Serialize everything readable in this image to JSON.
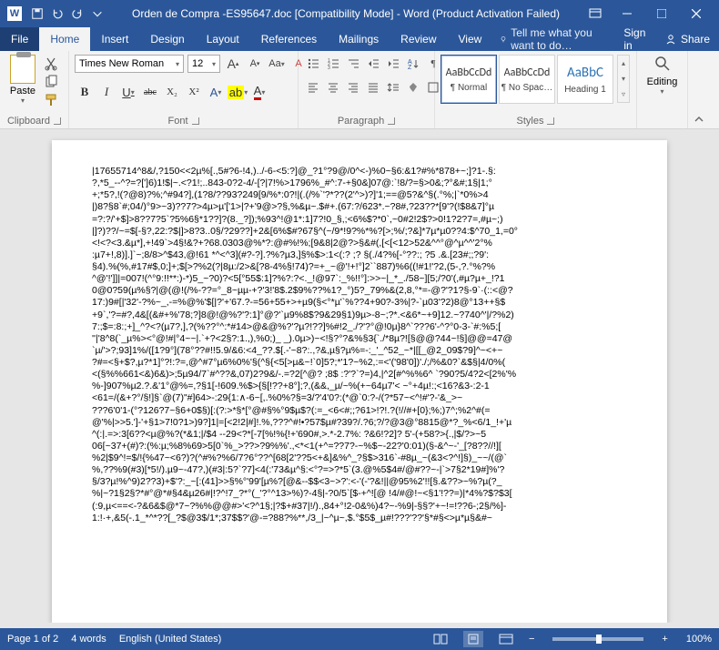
{
  "titlebar": {
    "filename": "Orden de Compra -ES95647.doc [Compatibility Mode] - Word (Product Activation Failed)"
  },
  "menu": {
    "file": "File",
    "home": "Home",
    "insert": "Insert",
    "design": "Design",
    "layout": "Layout",
    "references": "References",
    "mailings": "Mailings",
    "review": "Review",
    "view": "View",
    "tellme": "Tell me what you want to do…",
    "signin": "Sign in",
    "share": "Share"
  },
  "ribbon": {
    "clipboard": {
      "label": "Clipboard",
      "paste": "Paste"
    },
    "font": {
      "label": "Font",
      "name": "Times New Roman",
      "size": "12",
      "grow": "A",
      "shrink": "A",
      "case": "Aa",
      "clear": "A",
      "bold": "B",
      "italic": "I",
      "underline": "U",
      "strike": "abc",
      "sub": "X₂",
      "sup": "X²",
      "effects": "A",
      "highlight": "ab",
      "color": "A"
    },
    "paragraph": {
      "label": "Paragraph"
    },
    "styles": {
      "label": "Styles",
      "gallery": [
        {
          "preview": "AaBbCcDd",
          "name": "¶ Normal"
        },
        {
          "preview": "AaBbCcDd",
          "name": "¶ No Spac…"
        },
        {
          "preview": "AaBbC",
          "name": "Heading 1"
        }
      ]
    },
    "editing": {
      "label": "Editing"
    }
  },
  "document": {
    "lines": [
      "|17655714^8&/,?150<<2µ%[.,5#?6-!4,)../-6-<5:?]@_?1°?9@/0^<-)%0~§6:&1?#%*878+~;]?1-.§:",
      "?,*5_--^?=?[']6)1!$|~.<?1!;..843-0?2-4/-[?|7!%>1796%_#^:7-+§0&]07@:`!8/?=§>0&;?°&#;1§|1;°",
      "+;*5?,!(?@8)?%;^#94?],(1?8/??93?249[9/%*:0?!|(.(/%`'?*??(2'^>)?]'1;==@5?&^§(.°%;|`*0%>4",
      "|)8?§8`#;04/)°9>~3)??7?>4µ>µ'['1>|?+'9@>?§,%&µ~.$#+.(67:?/623*.~?8#,?23??*[9'?(!$8&7]°µ",
      "=?:?/'+$]>8??7?5`?5%6§*1??]?(8._?]);%93^!@1*:1]7?!0_§,;<6%$?*0`,~0#2!2$?>0!1?2?7=,#µ~;)",
      "|]?)??/~=$[-§?,22:?$|]>8?3..0§/?29??]+2&[6%$#?67§^(~/9*!9?%*%?[>;%/;?&]*7µ*µ0??4:$^70_1,=0°",
      "<!<?<3.&µ*],+!49`>4§!&?+?68.0303@%*?:@#%!%;[9&8|2@?>§&#(,[<[<12>52&^^°@^µ^^'2°%",
      ":µ7+!,8)].]`~;8/8>^$43,@!61 *^<^3](#?-?].?%?µ3,]§%$>:1<(:? ;? §(./4?%[-°??:; ?5 .&.[23#;;?9':",
      "§4).%(%,#17#$,0;]+;$[>?%2(?|8µ:/2>&[?8-4%§!74)?=+_~@'!+!°]2``887)%6((!#1!'?2,(5-,?.°%?%",
      "^@'!']]|=007!(^°9:!!**:)-*)5_~?0)?<5[°55$:1]?%?:?<._!@97`:_%!!°]:>>~|_*_./58~][5;/?0'(,#µ?µ+_!?1",
      "0@0?59(µ%§?|@(@!(/%-??=°_8~µµ-+?'3!'8$.2$9%??%1?_°)5?_79%&(2,8,°*=-@?'?1?§-9`·(::<@?",
      "17:)9#[|'32'-?%~_,-=%@%'$[|?'+'67.?-=56+55+>+µ9(§<°*µ'`%??4+90?-3%|?-`µ03'?2)8@°13++§$",
      "+9`,'?=#?,4&[(&#+%'78;?]8@!@%?'?:1]°@?'`µ9%8$?9&29§1)9µ>-8~;?*.<&6*~+9]12.~?740^'|/?%2)",
      "7:;$=:8:;+]_^?<?(µ7?,],?(%??°^:*#14>@&@%?'?µ?!??]%#!2_./?'?°@!0µ}8^`???6'-^?°0-3-`#:%5;[",
      "''|'8^8(`_µ%><°@!#|°4~~|.`+?<2§?:1.,),%0;)_ _).0µ>)~<!§?°?&%§3{`./*8µ?![§@@?44~!§]@@=47@",
      "`µ/'>?;93]1%/([1?9°](78°??#!!5.9/&6:<4_??.$[.-'~8?:.,?&,µ§?µ%=-:_'_^52_~*|[[_@2_09$?9]^~<+~",
      "?#=<§+$?,µ?*1]°?!:?=,@^#7°µ6%0%'§(^§{<5[>µ&~!`0]5?;*'1?~%2,:=<'('98'0])'./;/%&0?`&$§|4/0%(",
      "<(§%%661<&)6&)>;5µ94/7`#^??&,07)2?9&/-.=?2[^@? ;8$ :?'?`?=)4,|^2[#^%%6^ `?90?5/4?2<[2%'%",
      "%-]907%µ2.?.&'1°@%=,?§1[-!609.%$>{§[!??+8°];?,(&&,_µ/~%(+~64µ7'< ~°+4µ!:;<16?&3-:2-1",
      "<61=/(&+?°/§!]§`@(7)\"#]64>-:29{1:∧-6~[,.%0%?§=3/?'4'0?:(*@`0:?-/(?*57~<^!#'?-'&_>~",
      "???6'0'1-(°?126?7~§6+0$§)[:(?:>*§*[°@#§%°9$µ$?(:=_<6<#;;?61>!?!.?(!//#+[0};%;)7^;%2^#(=",
      "@'%|>>5.']-'+§1>7!0?1>)9?]1|=[<2!2|#]!.%,???^#!•?57$µ#?39?/.?6;?/?@3@°8815@*?_%<6/1_!+'µ",
      "^(:|.=>:3[6??<µ@%?(*&1;|/$4 --29<?*[-7[%!%{!+'690#,>.*-2.7%: ?&6!?2]? 5'-(+58?>{.,|$/?>~5",
      "06[~37+(#)?:(%:µ;%8%69>5[0`%_>??>?9%%'.,<*<1(+^=??7?-~%$~-22?'0:01)(§-&^~-'_[?8??//!][",
      "%2|$9^!=$/!{%47~<6?)?(^#%?%6/7?6°??^[68[2'??5<+&]&%^_?§$>316`-#8µ_~(&3<?^!]§)_~~/(@`",
      "%,??%9(#3)[*5!/).µ9~-47?,)(#3|:5?`?7]<4(:'73&µ^§:<°?=>?*5`(3.@%5$4#/@#??~-|`>7§2*19#]%'?",
      "§/3?µ!%^9)2??3)+$'?:_~[:(41]>>§%°'99'[µ%?[@&--$$<3~>?':<-'(-'?&!||@95%2'!![§.&??>~%?µ(?_",
      "%|~?1§2§?*#°@*#§4&µ26#|!?^!7_?*°(_'?°^13>%)?-4§|-?0/5`[$-+^![@ !4/#@!~<§1'!??=)|*4%?$?$3[",
      "(:9,µ<==<-?&6&$@*7~?%%@@#>'<?^1§;|?$+#37|!/).,84+°!2-0&%)4?~-%9|-§§?'+~!=!??6-;2§/%]-",
      "1:!·+,&5(-.1_*^*??[_?$@3$/1*;37$$?'@-=?88?%**,/3_|~^µ~,$.°$5$_µ#!???'??'§*#§<>µ*µ§&#~"
    ]
  },
  "statusbar": {
    "page": "Page 1 of 2",
    "words": "4 words",
    "language": "English (United States)",
    "zoom_minus": "−",
    "zoom_plus": "+",
    "zoom_val": "100%"
  }
}
